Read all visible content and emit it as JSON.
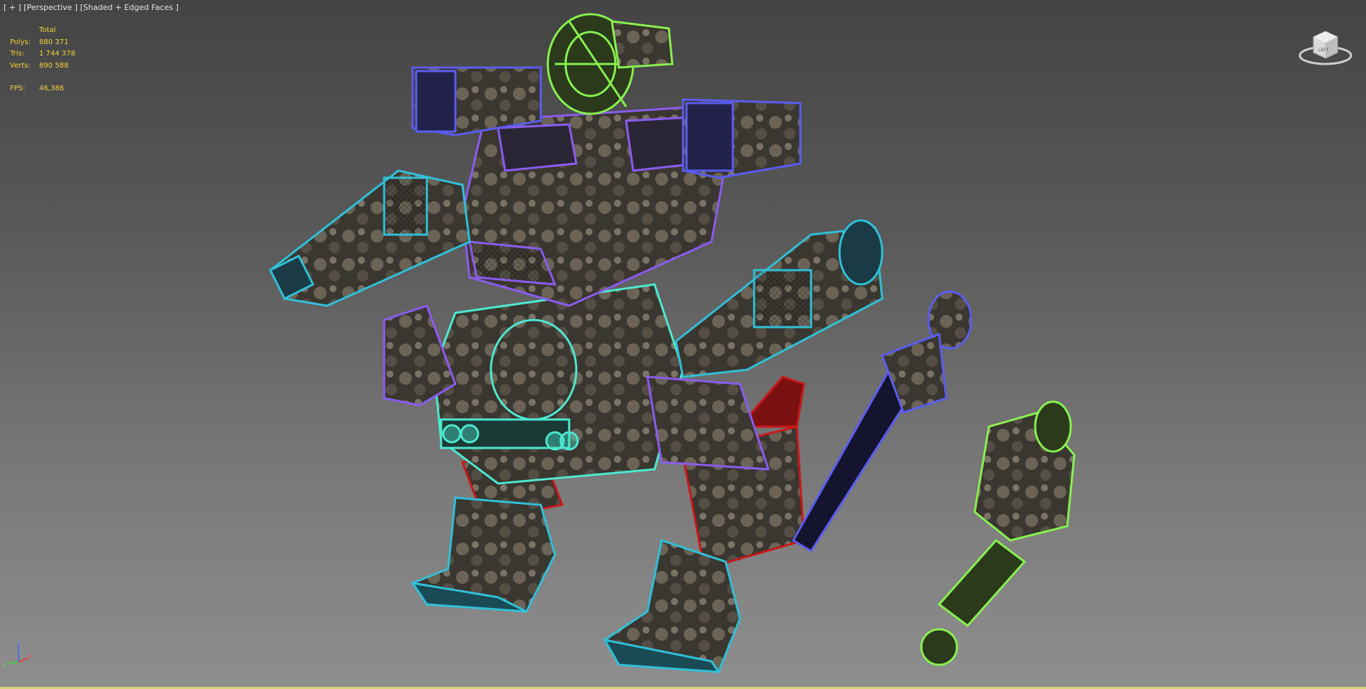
{
  "viewport": {
    "label_parts": [
      "[ + ]",
      "[Perspective ]",
      "[Shaded + Edged Faces ]"
    ]
  },
  "stats": {
    "header": "Total",
    "rows": [
      {
        "label": "Polys:",
        "value": "880 371"
      },
      {
        "label": "Tris:",
        "value": "1 744 378"
      },
      {
        "label": "Verts:",
        "value": "890 588"
      }
    ],
    "fps_label": "FPS:",
    "fps_value": "46,386"
  },
  "viewcube": {
    "face_label": "LEFT"
  },
  "axis": {
    "x": "x",
    "y": "y",
    "z": "z"
  },
  "colors": {
    "stats_text": "#f0d33a",
    "wire_purple": "#8a5cf0",
    "wire_blue": "#5a5cf0",
    "wire_cyan": "#30c0d8",
    "wire_teal": "#4de8d0",
    "wire_green": "#88f050",
    "wire_red": "#c81818"
  }
}
